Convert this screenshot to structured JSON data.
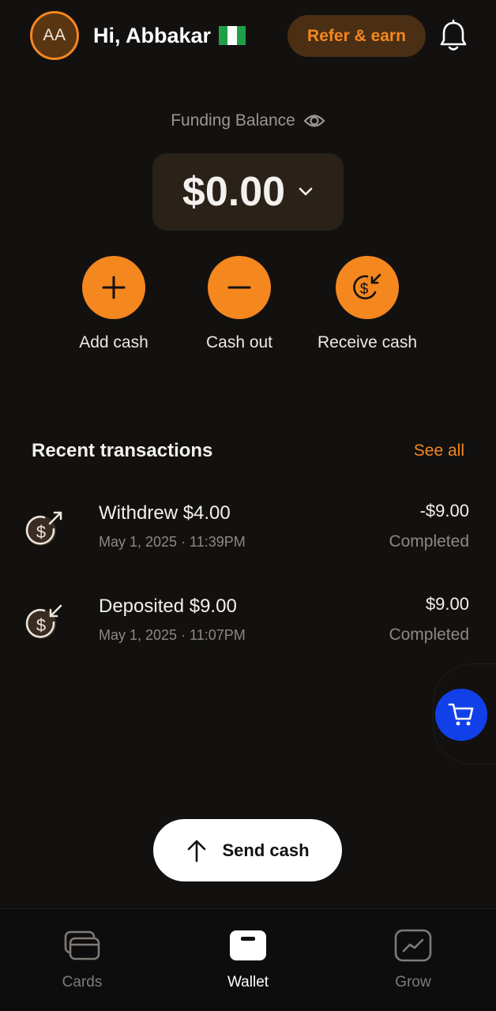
{
  "header": {
    "avatar_initials": "AA",
    "greeting": "Hi, Abbakar",
    "flag": "nigeria-flag",
    "refer_label": "Refer & earn",
    "bell_icon": "bell-icon"
  },
  "balance": {
    "label": "Funding Balance",
    "amount": "$0.00"
  },
  "actions": [
    {
      "label": "Add cash",
      "icon": "plus-icon"
    },
    {
      "label": "Cash out",
      "icon": "minus-icon"
    },
    {
      "label": "Receive cash",
      "icon": "receive-dollar-icon"
    }
  ],
  "transactions": {
    "title": "Recent transactions",
    "see_all": "See all",
    "items": [
      {
        "name": "Withdrew $4.00",
        "date": "May 1, 2025 · 11:39PM",
        "amount": "-$9.00",
        "status": "Completed",
        "icon": "withdraw-dollar-icon"
      },
      {
        "name": "Deposited $9.00",
        "date": "May 1, 2025 · 11:07PM",
        "amount": "$9.00",
        "status": "Completed",
        "icon": "deposit-dollar-icon"
      }
    ]
  },
  "send_cash": {
    "label": "Send cash"
  },
  "nav": [
    {
      "label": "Cards",
      "icon": "cards-icon",
      "active": false
    },
    {
      "label": "Wallet",
      "icon": "wallet-icon",
      "active": true
    },
    {
      "label": "Grow",
      "icon": "grow-chart-icon",
      "active": false
    }
  ],
  "colors": {
    "accent": "#f5871f",
    "background": "#121110",
    "cart_button": "#1240e8"
  }
}
